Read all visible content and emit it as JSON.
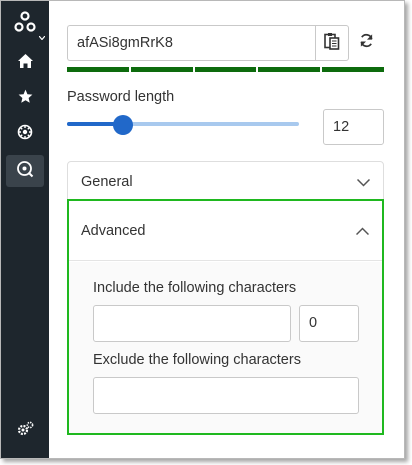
{
  "sidebar": {
    "items": [
      {
        "icon": "logo-icon"
      },
      {
        "icon": "home-icon"
      },
      {
        "icon": "star-icon"
      },
      {
        "icon": "gear-icon"
      },
      {
        "icon": "password-generator-icon",
        "active": true
      },
      {
        "icon": "settings-icon"
      }
    ]
  },
  "generator": {
    "password_value": "afASi8gmRrK8",
    "strength_segments": 5,
    "strength_filled": 5,
    "strength_color": "#0d6b0d",
    "length_label": "Password length",
    "length_value": "12",
    "length_slider_fraction": 0.24
  },
  "panels": {
    "general_label": "General",
    "advanced_label": "Advanced",
    "include_label": "Include the following characters",
    "include_value": "",
    "include_count": "0",
    "exclude_label": "Exclude the following characters",
    "exclude_value": ""
  },
  "colors": {
    "sidebar_bg": "#1e262d",
    "accent": "#2168c9",
    "highlight_border": "#1fb81f"
  }
}
